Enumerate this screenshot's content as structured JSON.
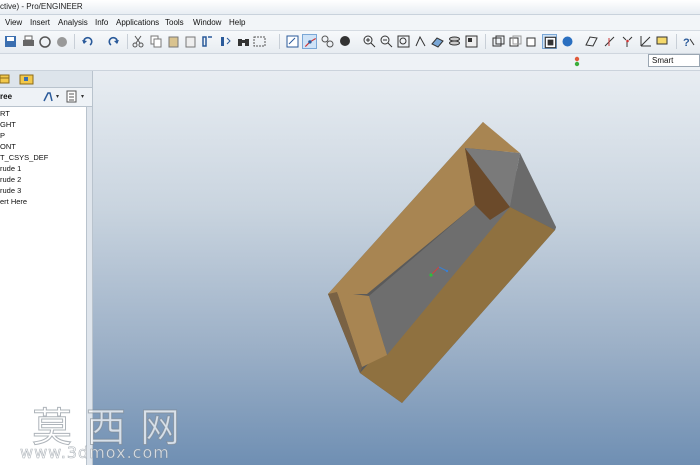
{
  "window": {
    "title": "ctive) - Pro/ENGINEER"
  },
  "menu": {
    "items": [
      {
        "label": "View"
      },
      {
        "label": "Insert"
      },
      {
        "label": "Analysis"
      },
      {
        "label": "Info"
      },
      {
        "label": "Applications"
      },
      {
        "label": "Tools"
      },
      {
        "label": "Window"
      },
      {
        "label": "Help"
      }
    ]
  },
  "filter": {
    "value": "Smart"
  },
  "sidebar": {
    "tree_header": "ree",
    "items": [
      {
        "label": "RT"
      },
      {
        "label": "GHT"
      },
      {
        "label": "P"
      },
      {
        "label": "ONT"
      },
      {
        "label": "T_CSYS_DEF"
      },
      {
        "label": "rude 1"
      },
      {
        "label": "rude 2"
      },
      {
        "label": "rude 3"
      },
      {
        "label": "ert Here"
      }
    ]
  },
  "model": {
    "outer_color": "#8f7140",
    "inner_color": "#6e6e6e",
    "wall_color": "#a88552"
  },
  "watermark": {
    "chinese": "莫西网",
    "url": "www.3dmox.com"
  }
}
